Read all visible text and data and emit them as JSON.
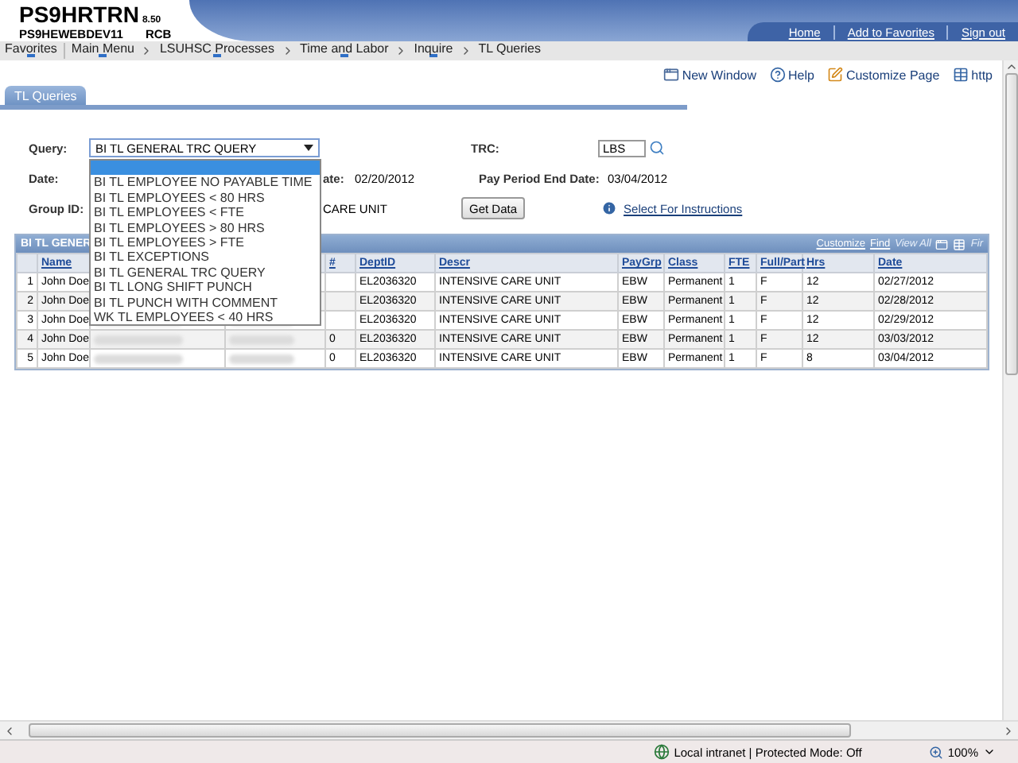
{
  "header": {
    "title": "PS9HRTRN",
    "version": "8.50",
    "server": "PS9HEWEBDEV11",
    "user": "RCB",
    "links": [
      "Home",
      "Add to Favorites",
      "Sign out"
    ]
  },
  "breadcrumbs": [
    {
      "label": "Favorites",
      "has_menu": true
    },
    {
      "label": "Main Menu",
      "has_menu": true
    },
    {
      "label": "LSUHSC Processes",
      "has_menu": true
    },
    {
      "label": "Time and Labor",
      "has_menu": true
    },
    {
      "label": "Inquire",
      "has_menu": true
    },
    {
      "label": "TL Queries",
      "has_menu": false
    }
  ],
  "page_tools": [
    {
      "kind": "window",
      "label": "New Window"
    },
    {
      "kind": "help",
      "label": "Help"
    },
    {
      "kind": "edit",
      "label": "Customize Page"
    },
    {
      "kind": "table",
      "label": "http"
    }
  ],
  "tabs": [
    {
      "label": "TL Queries",
      "selected": true
    }
  ],
  "form": {
    "query_label": "Query:",
    "query_value": "BI TL GENERAL TRC QUERY",
    "options": [
      {
        "selected": true
      },
      {
        "label": "BI TL EMPLOYEE NO PAYABLE TIME",
        "selected": false
      },
      {
        "label": "BI TL EMPLOYEES < 80 HRS",
        "selected": false
      },
      {
        "label": "BI TL EMPLOYEES < FTE",
        "selected": false
      },
      {
        "label": "BI TL EMPLOYEES > 80 HRS",
        "selected": false
      },
      {
        "label": "BI TL EMPLOYEES > FTE",
        "selected": false
      },
      {
        "label": "BI TL EXCEPTIONS",
        "selected": false
      },
      {
        "label": "BI TL GENERAL TRC QUERY",
        "selected": false
      },
      {
        "label": "BI TL LONG SHIFT PUNCH",
        "selected": false
      },
      {
        "label": "BI TL PUNCH WITH COMMENT",
        "selected": false
      },
      {
        "label": "WK TL EMPLOYEES < 40 HRS",
        "selected": false
      }
    ],
    "date_label": "Date:",
    "begin_date_label": "ate:",
    "begin_date": "02/20/2012",
    "trc_label": "TRC:",
    "trc_value": "LBS",
    "end_date_label": "Pay Period End Date:",
    "end_date": "03/04/2012",
    "group_label": "Group ID:",
    "group_descr": "CARE UNIT",
    "get_data": "Get Data",
    "instructions": "Select For Instructions"
  },
  "grid": {
    "title": "BI TL GENER",
    "tools": [
      {
        "label": "Customize",
        "disabled": false
      },
      {
        "label": "Find",
        "disabled": false
      },
      {
        "label": "View All",
        "disabled": true
      }
    ],
    "nav_label": "Fir",
    "columns": [
      {
        "kind": "text",
        "label": "Name"
      },
      {
        "kind": "redacted"
      },
      {
        "kind": "redacted"
      },
      {
        "kind": "text",
        "label": "#"
      },
      {
        "kind": "text",
        "label": "DeptID"
      },
      {
        "kind": "text",
        "label": "Descr"
      },
      {
        "kind": "text",
        "label": "PayGrp"
      },
      {
        "kind": "text",
        "label": "Class"
      },
      {
        "kind": "text",
        "label": "FTE"
      },
      {
        "kind": "text",
        "label": "Full/Part"
      },
      {
        "kind": "text",
        "label": "Hrs"
      },
      {
        "kind": "text",
        "label": "Date"
      }
    ],
    "rows": [
      {
        "num": "1",
        "name": "John Doe",
        "deptid": "EL2036320",
        "descr": "INTENSIVE CARE UNIT",
        "paygrp": "EBW",
        "class": "Permanent",
        "fte": "1",
        "full_part": "F",
        "hrs": "12",
        "date": "02/27/2012"
      },
      {
        "num": "2",
        "name": "John Doe",
        "deptid": "EL2036320",
        "descr": "INTENSIVE CARE UNIT",
        "paygrp": "EBW",
        "class": "Permanent",
        "fte": "1",
        "full_part": "F",
        "hrs": "12",
        "date": "02/28/2012"
      },
      {
        "num": "3",
        "name": "John Doe",
        "deptid": "EL2036320",
        "descr": "INTENSIVE CARE UNIT",
        "paygrp": "EBW",
        "class": "Permanent",
        "fte": "1",
        "full_part": "F",
        "hrs": "12",
        "date": "02/29/2012"
      },
      {
        "num": "4",
        "name": "John Doe",
        "col_4": "0",
        "deptid": "EL2036320",
        "descr": "INTENSIVE CARE UNIT",
        "paygrp": "EBW",
        "class": "Permanent",
        "fte": "1",
        "full_part": "F",
        "hrs": "12",
        "date": "03/03/2012"
      },
      {
        "num": "5",
        "name": "John Doe",
        "col_4": "0",
        "deptid": "EL2036320",
        "descr": "INTENSIVE CARE UNIT",
        "paygrp": "EBW",
        "class": "Permanent",
        "fte": "1",
        "full_part": "F",
        "hrs": "8",
        "date": "03/04/2012"
      }
    ]
  },
  "status": {
    "zone": "Local intranet | Protected Mode: Off",
    "zoom": "100%"
  }
}
